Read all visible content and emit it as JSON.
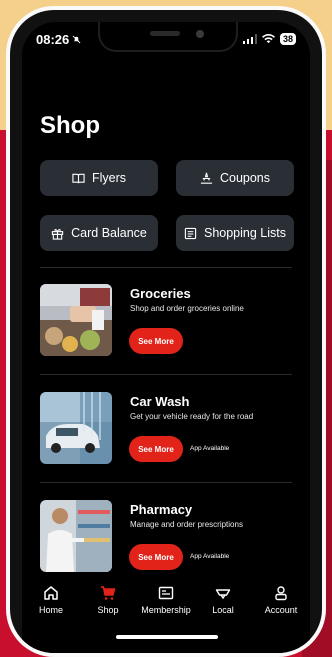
{
  "status": {
    "time": "08:26",
    "battery": "38"
  },
  "page_title": "Shop",
  "quick": {
    "flyers": "Flyers",
    "coupons": "Coupons",
    "card_balance": "Card Balance",
    "shopping_lists": "Shopping Lists"
  },
  "services": [
    {
      "name": "Groceries",
      "desc": "Shop and order groceries online",
      "cta": "See More",
      "badge": ""
    },
    {
      "name": "Car Wash",
      "desc": "Get your vehicle ready for the road",
      "cta": "See More",
      "badge": "App Available"
    },
    {
      "name": "Pharmacy",
      "desc": "Manage and order prescriptions",
      "cta": "See More",
      "badge": "App Available"
    }
  ],
  "tabs": [
    {
      "label": "Home",
      "icon": "home-icon"
    },
    {
      "label": "Shop",
      "icon": "cart-icon",
      "active": true
    },
    {
      "label": "Membership",
      "icon": "card-icon"
    },
    {
      "label": "Local",
      "icon": "location-icon"
    },
    {
      "label": "Account",
      "icon": "person-icon"
    }
  ],
  "colors": {
    "accent": "#e2231a",
    "button_bg": "#2a2f36",
    "screen_bg": "#000000"
  }
}
